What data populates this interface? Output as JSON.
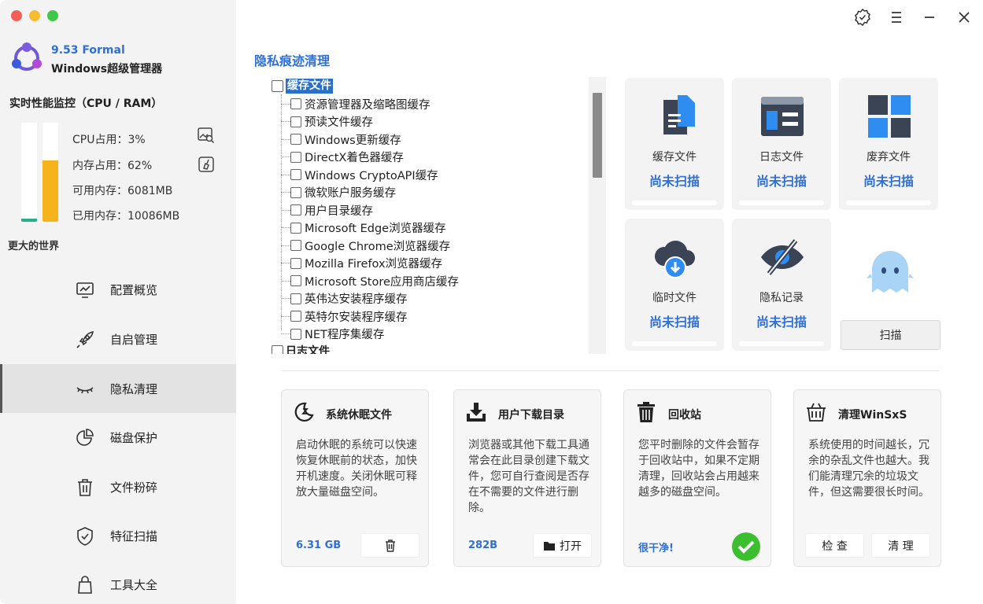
{
  "window": {
    "dot_colors": [
      "#f25f58",
      "#f7bd2e",
      "#3ec84a"
    ]
  },
  "brand": {
    "version": "9.53 Formal",
    "name": "Windows超级管理器"
  },
  "perf": {
    "title": "实时性能监控（CPU / RAM）",
    "cpu_percent": 3,
    "mem_percent": 62,
    "cpu_label": "CPU占用：3%",
    "mem_label": "内存占用：62%",
    "avail_label": "可用内存：6081MB",
    "used_label": "已用内存：10086MB"
  },
  "world": "更大的世界",
  "nav": [
    {
      "label": "配置概览",
      "icon": "monitor-chart-icon"
    },
    {
      "label": "自启管理",
      "icon": "rocket-icon"
    },
    {
      "label": "隐私清理",
      "icon": "closed-eye-icon",
      "active": true
    },
    {
      "label": "磁盘保护",
      "icon": "pie-chart-icon"
    },
    {
      "label": "文件粉碎",
      "icon": "trash-icon"
    },
    {
      "label": "特征扫描",
      "icon": "shield-check-icon"
    },
    {
      "label": "工具大全",
      "icon": "bag-icon"
    }
  ],
  "section_title": "隐私痕迹清理",
  "tree": {
    "group1": "缓存文件",
    "group2": "日志文件",
    "items": [
      "资源管理器及缩略图缓存",
      "预读文件缓存",
      "Windows更新缓存",
      "DirectX着色器缓存",
      "Windows CryptoAPI缓存",
      "微软账户服务缓存",
      "用户目录缓存",
      "Microsoft Edge浏览器缓存",
      "Google Chrome浏览器缓存",
      "Mozilla Firefox浏览器缓存",
      "Microsoft Store应用商店缓存",
      "英伟达安装程序缓存",
      "英特尔安装程序缓存",
      "NET程序集缓存"
    ]
  },
  "tiles": [
    {
      "label": "缓存文件",
      "status": "尚未扫描",
      "icon": "documents-icon"
    },
    {
      "label": "日志文件",
      "status": "尚未扫描",
      "icon": "log-window-icon"
    },
    {
      "label": "废弃文件",
      "status": "尚未扫描",
      "icon": "windows-grid-icon"
    },
    {
      "label": "临时文件",
      "status": "尚未扫描",
      "icon": "cloud-download-icon"
    },
    {
      "label": "隐私记录",
      "status": "尚未扫描",
      "icon": "eye-slash-icon"
    }
  ],
  "scan_button": "扫描",
  "cards": [
    {
      "title": "系统休眠文件",
      "desc": "启动休眠的系统可以快速恢复休眠前的状态，加快开机速度。关闭休眠可释放大量磁盘空间。",
      "value": "6.31 GB",
      "icon": "sleep-icon"
    },
    {
      "title": "用户下载目录",
      "desc": "浏览器或其他下载工具通常会在此目录创建下载文件，您可自行查阅是否存在不需要的文件进行删除。",
      "value": "282B",
      "button": "打开",
      "icon": "download-tray-icon"
    },
    {
      "title": "回收站",
      "desc": "您平时删除的文件会暂存于回收站中，如果不定期清理，回收站会占用越来越多的磁盘空间。",
      "value": "很干净!",
      "icon": "recycle-bin-icon"
    },
    {
      "title": "清理WinSxS",
      "desc": "系统使用的时间越长，冗余的杂乱文件也越大。我们能清理冗余的垃圾文件，但这需要很长时间。",
      "btn_check": "检 查",
      "btn_clean": "清 理",
      "icon": "basket-icon"
    }
  ],
  "colors": {
    "accent": "#2f6fd6",
    "cpu_bar": "#25b08a",
    "mem_bar": "#f6b31b",
    "ok": "#3bbf2e"
  }
}
